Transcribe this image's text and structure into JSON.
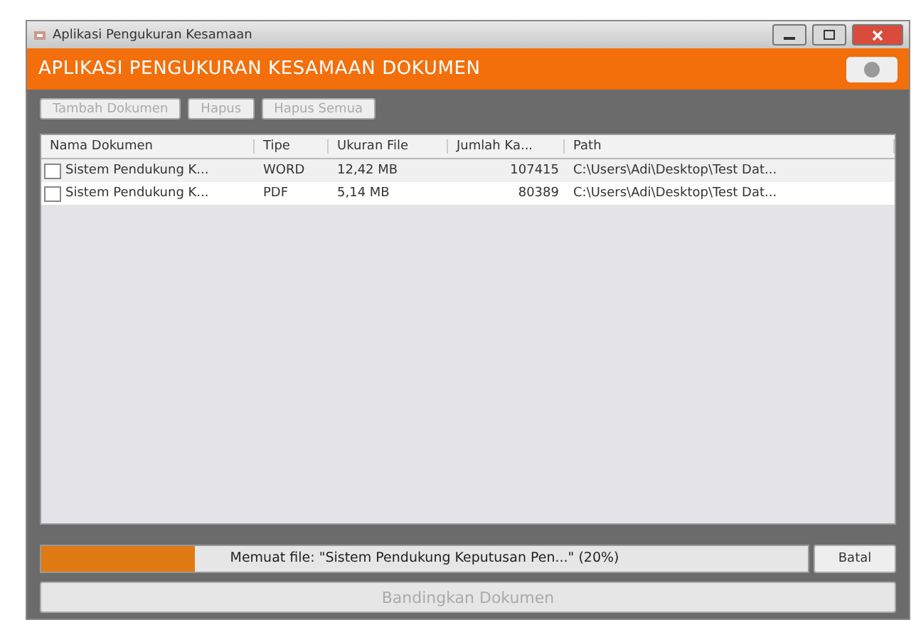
{
  "window": {
    "title": "Aplikasi Pengukuran Kesamaan"
  },
  "header": {
    "title": "APLIKASI PENGUKURAN KESAMAAN DOKUMEN"
  },
  "toolbar": [
    {
      "label": "Tambah Dokumen",
      "disabled": true
    },
    {
      "label": "Hapus",
      "disabled": true
    },
    {
      "label": "Hapus Semua",
      "disabled": true
    }
  ],
  "table": {
    "columns": [
      "Nama Dokumen",
      "Tipe",
      "Ukuran File",
      "Jumlah Ka...",
      "Path"
    ],
    "rows": [
      {
        "checked": false,
        "cells": [
          "Sistem Pendukung K...",
          "WORD",
          "12,42 MB",
          "107415",
          "C:\\Users\\Adi\\Desktop\\Test Dat..."
        ]
      },
      {
        "checked": false,
        "cells": [
          "Sistem Pendukung K...",
          "PDF",
          "5,14 MB",
          "80389",
          "C:\\Users\\Adi\\Desktop\\Test Dat..."
        ]
      }
    ]
  },
  "progress": {
    "level": 0.2,
    "text": "Memuat file: \"Sistem Pendukung Keputusan Pen...\" (20%)"
  },
  "cancel_button": {
    "label": "Batal"
  },
  "compare_button": {
    "label": "Bandingkan Dokumen",
    "disabled": true
  }
}
